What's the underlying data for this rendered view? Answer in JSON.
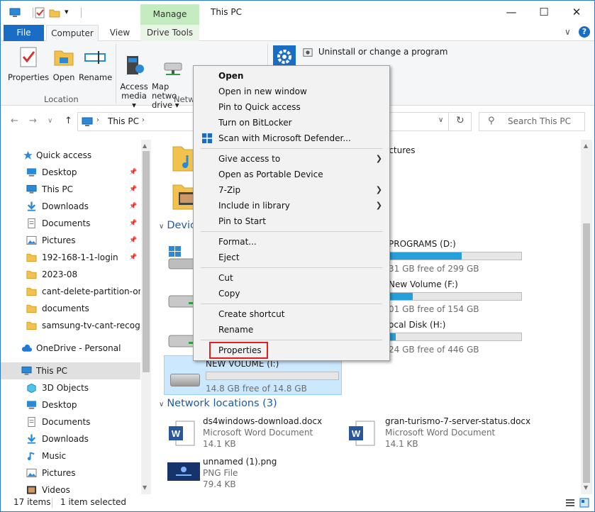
{
  "window": {
    "title": "This PC",
    "manage_tab": "Manage",
    "controls": {
      "minimize": "—",
      "maximize": "☐",
      "close": "✕"
    }
  },
  "tabs": {
    "file": "File",
    "computer": "Computer",
    "view": "View",
    "drive_tools": "Drive Tools"
  },
  "ribbon": {
    "properties": "Properties",
    "open": "Open",
    "rename": "Rename",
    "location_group": "Location",
    "access_media": "Access\nmedia ▾",
    "map_network_drive": "Map netwo\ndrive ▾",
    "network_group": "Netw",
    "uninstall": "Uninstall or change a program"
  },
  "address": {
    "path_root": "This PC",
    "search_placeholder": "Search This PC"
  },
  "nav": {
    "quick_access": "Quick access",
    "items": [
      {
        "label": "Desktop",
        "pinned": true
      },
      {
        "label": "This PC",
        "pinned": true
      },
      {
        "label": "Downloads",
        "pinned": true
      },
      {
        "label": "Documents",
        "pinned": true
      },
      {
        "label": "Pictures",
        "pinned": true
      },
      {
        "label": "192-168-1-1-login",
        "pinned": true
      },
      {
        "label": "2023-08",
        "pinned": false
      },
      {
        "label": "cant-delete-partition-on-s",
        "pinned": false
      },
      {
        "label": "documents",
        "pinned": false
      },
      {
        "label": "samsung-tv-cant-recogniz",
        "pinned": false
      }
    ],
    "onedrive": "OneDrive - Personal",
    "this_pc": "This PC",
    "this_pc_children": [
      "3D Objects",
      "Desktop",
      "Documents",
      "Downloads",
      "Music",
      "Pictures",
      "Videos"
    ]
  },
  "content": {
    "pictures_label": "ictures",
    "devices_header": "Devic",
    "drives": [
      {
        "name": "PROGRAMS (D:)",
        "free": "31 GB free of 299 GB",
        "used_fraction": 0.55
      },
      {
        "name": "New Volume (F:)",
        "free": "01 GB free of 154 GB",
        "used_fraction": 0.18
      },
      {
        "name": "ocal Disk (H:)",
        "free": "24 GB free of 446 GB",
        "used_fraction": 0.05
      },
      {
        "name": "NEW VOLUME (I:)",
        "free": "14.8 GB free of 14.8 GB",
        "used_fraction": 0.0
      }
    ],
    "network_header": "Network locations (3)",
    "files": [
      {
        "name": "ds4windows-download.docx",
        "type": "Microsoft Word Document",
        "size": "14.1 KB",
        "kind": "word"
      },
      {
        "name": "gran-turismo-7-server-status.docx",
        "type": "Microsoft Word Document",
        "size": "14.1 KB",
        "kind": "word"
      },
      {
        "name": "unnamed (1).png",
        "type": "PNG File",
        "size": "79.4 KB",
        "kind": "image"
      }
    ]
  },
  "status": {
    "items_count": "17 items",
    "selected": "1 item selected"
  },
  "context_menu": [
    {
      "label": "Open",
      "bold": true
    },
    {
      "label": "Open in new window"
    },
    {
      "label": "Pin to Quick access"
    },
    {
      "label": "Turn on BitLocker"
    },
    {
      "label": "Scan with Microsoft Defender...",
      "icon": "defender-icon"
    },
    {
      "sep": true
    },
    {
      "label": "Give access to",
      "submenu": true
    },
    {
      "label": "Open as Portable Device"
    },
    {
      "label": "7-Zip",
      "submenu": true
    },
    {
      "label": "Include in library",
      "submenu": true
    },
    {
      "label": "Pin to Start"
    },
    {
      "sep": true
    },
    {
      "label": "Format..."
    },
    {
      "label": "Eject"
    },
    {
      "sep": true
    },
    {
      "label": "Cut"
    },
    {
      "label": "Copy"
    },
    {
      "sep": true
    },
    {
      "label": "Create shortcut"
    },
    {
      "label": "Rename"
    },
    {
      "sep": true
    },
    {
      "label": "Properties",
      "highlighted": true
    }
  ],
  "colors": {
    "accent": "#1a6dc4",
    "selection": "#cce8ff",
    "manage": "#c5ecc1",
    "highlight_box": "#e02020",
    "drive_bar": "#26a0da"
  }
}
